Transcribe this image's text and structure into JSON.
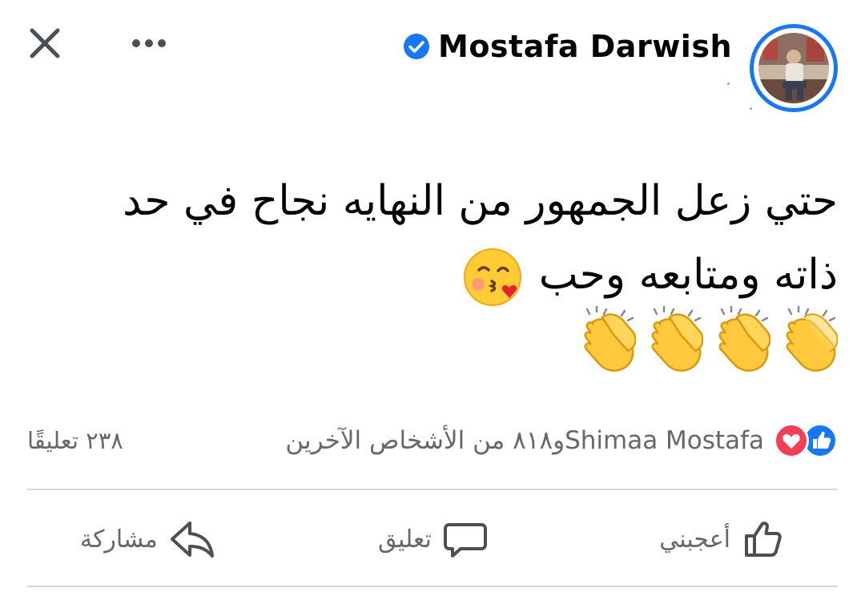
{
  "header": {
    "author_name": "Mostafa Darwish",
    "verified": true
  },
  "post": {
    "lines": [
      "حتي زعل الجمهور  من النهايه نجاح في حد",
      "ذاته ومتابعه وحب"
    ],
    "inline_emoji": "face-blowing-a-kiss",
    "trailing_emojis": [
      "clapping-hands",
      "clapping-hands",
      "clapping-hands",
      "clapping-hands"
    ]
  },
  "reactions": {
    "types": [
      "like",
      "love"
    ],
    "first_name": "Shimaa Mostafa",
    "others_text": "و٨١٨ من الأشخاص الآخرين"
  },
  "comments": {
    "count_text": "٢٣٨ تعليقًا"
  },
  "actions": {
    "like_label": "أعجبني",
    "comment_label": "تعليق",
    "share_label": "مشاركة"
  },
  "colors": {
    "accent": "#1877f2",
    "love": "#f33e58",
    "secondary_text": "#65676b",
    "emoji_yellow": "#ffcc33"
  }
}
